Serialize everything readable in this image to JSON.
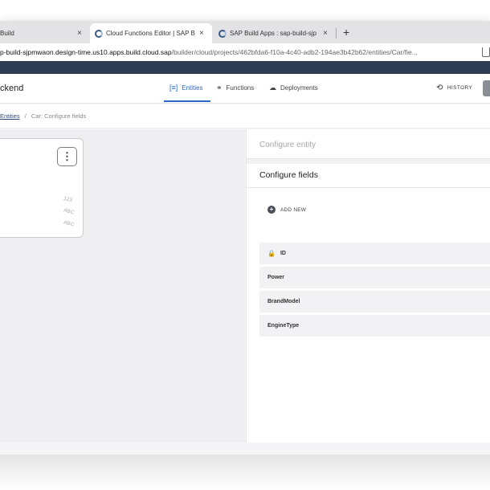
{
  "browser": {
    "tabs": [
      {
        "title": "Build",
        "close": "×"
      },
      {
        "title": "Cloud Functions Editor | SAP B",
        "close": "×"
      },
      {
        "title": "SAP Build Apps : sap-build-sjp",
        "close": "×"
      }
    ],
    "new_tab": "+",
    "url": {
      "host": "p-build-sjpmwaon.design-time.us10.apps.build.cloud.sap",
      "path": "/builder/cloud/projects/462bfda6-f10a-4c40-adb2-194ae3b42b62/entities/Car/fie..."
    }
  },
  "header": {
    "title": "ckend",
    "nav": [
      {
        "label": "Entities",
        "icon": "entities-icon",
        "glyph": "[≡]"
      },
      {
        "label": "Functions",
        "icon": "functions-icon",
        "glyph": "⚭"
      },
      {
        "label": "Deployments",
        "icon": "deployments-icon",
        "glyph": "☁"
      }
    ],
    "history": {
      "label": "HISTORY",
      "glyph": "⟲"
    },
    "accent": "#2868c8"
  },
  "breadcrumb": {
    "link": "Entities",
    "separator": "/",
    "current": "Car: Configure fields"
  },
  "canvas": {
    "kebab": "⋮",
    "type_icons": [
      "123",
      "ABC",
      "ABC"
    ]
  },
  "panel": {
    "configure_entity": "Configure entity",
    "configure_fields": "Configure fields",
    "add_new": "ADD NEW",
    "add_glyph": "+",
    "lock_glyph": "🔒",
    "fields": [
      "ID",
      "Power",
      "BrandModel",
      "EngineType"
    ]
  }
}
